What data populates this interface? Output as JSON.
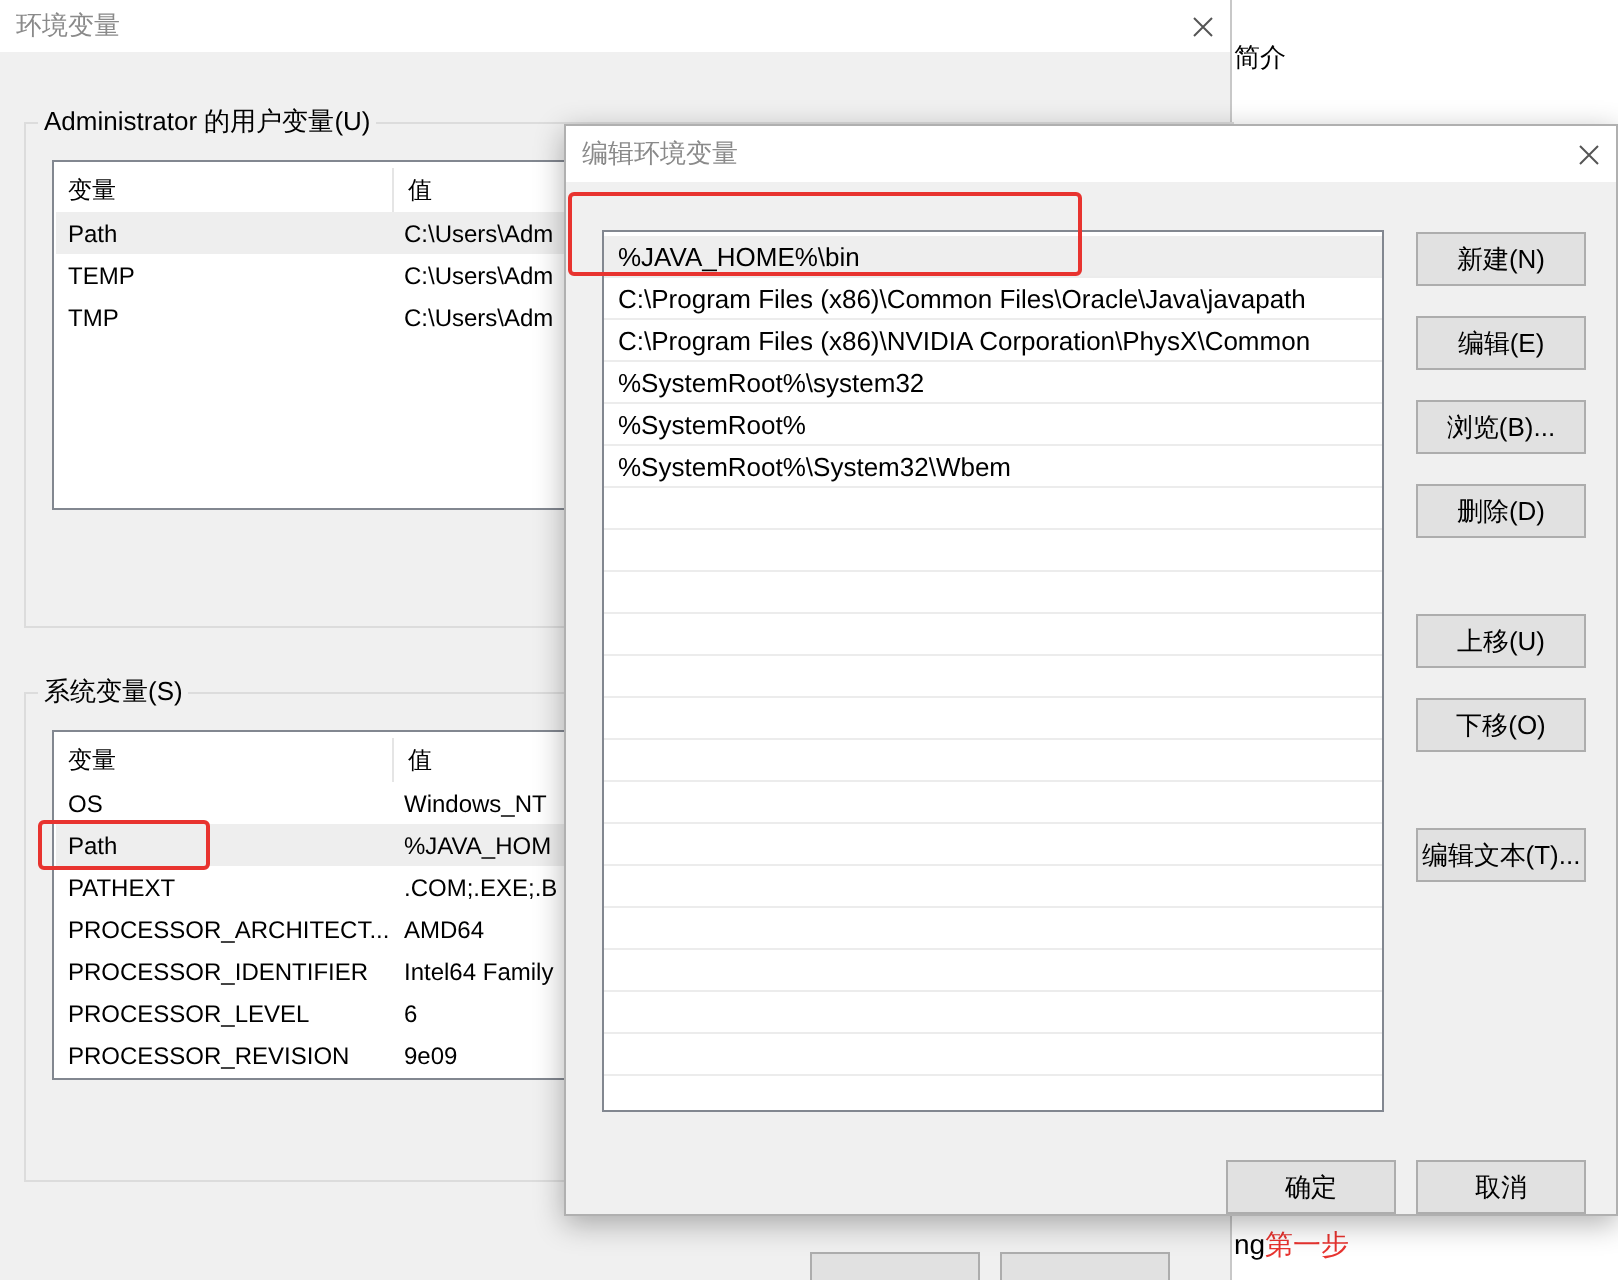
{
  "main_window": {
    "title": "环境变量",
    "user_group": {
      "label": "Administrator 的用户变量(U)",
      "columns": [
        "变量",
        "值"
      ],
      "rows": [
        {
          "name": "Path",
          "value": "C:\\Users\\Adm",
          "selected": true
        },
        {
          "name": "TEMP",
          "value": "C:\\Users\\Adm",
          "selected": false
        },
        {
          "name": "TMP",
          "value": "C:\\Users\\Adm",
          "selected": false
        }
      ]
    },
    "system_group": {
      "label": "系统变量(S)",
      "columns": [
        "变量",
        "值"
      ],
      "rows": [
        {
          "name": "OS",
          "value": "Windows_NT",
          "selected": false,
          "highlighted": false
        },
        {
          "name": "Path",
          "value": "%JAVA_HOM",
          "selected": true,
          "highlighted": true
        },
        {
          "name": "PATHEXT",
          "value": ".COM;.EXE;.B",
          "selected": false,
          "highlighted": false
        },
        {
          "name": "PROCESSOR_ARCHITECT...",
          "value": "AMD64",
          "selected": false,
          "highlighted": false
        },
        {
          "name": "PROCESSOR_IDENTIFIER",
          "value": "Intel64 Family",
          "selected": false,
          "highlighted": false
        },
        {
          "name": "PROCESSOR_LEVEL",
          "value": "6",
          "selected": false,
          "highlighted": false
        },
        {
          "name": "PROCESSOR_REVISION",
          "value": "9e09",
          "selected": false,
          "highlighted": false
        }
      ]
    }
  },
  "web_page": {
    "heading": "简介",
    "footer_text": "ng",
    "footer_red_text": "第一步"
  },
  "edit_dialog": {
    "title": "编辑环境变量",
    "entries": [
      {
        "text": "%JAVA_HOME%\\bin",
        "selected": true,
        "highlighted": true
      },
      {
        "text": "C:\\Program Files (x86)\\Common Files\\Oracle\\Java\\javapath",
        "selected": false,
        "highlighted": false
      },
      {
        "text": "C:\\Program Files (x86)\\NVIDIA Corporation\\PhysX\\Common",
        "selected": false,
        "highlighted": false
      },
      {
        "text": "%SystemRoot%\\system32",
        "selected": false,
        "highlighted": false
      },
      {
        "text": "%SystemRoot%",
        "selected": false,
        "highlighted": false
      },
      {
        "text": "%SystemRoot%\\System32\\Wbem",
        "selected": false,
        "highlighted": false
      }
    ],
    "side_button_groups": [
      [
        "新建(N)",
        "编辑(E)",
        "浏览(B)...",
        "删除(D)"
      ],
      [
        "上移(U)",
        "下移(O)"
      ],
      [
        "编辑文本(T)..."
      ]
    ],
    "buttons": [
      "确定",
      "取消"
    ]
  }
}
